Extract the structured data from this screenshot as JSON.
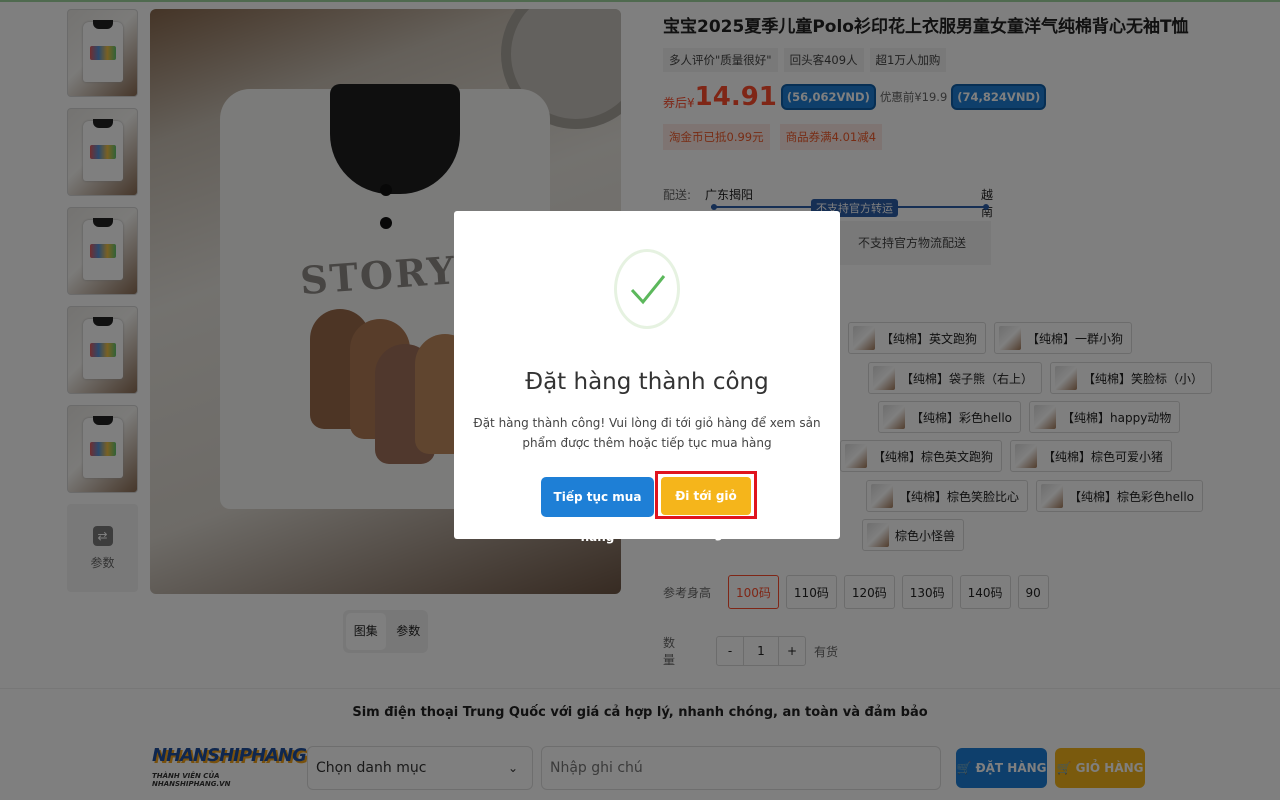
{
  "product": {
    "title": "宝宝2025夏季儿童Polo衫印花上衣服男童女童洋气纯棉背心无袖T恤",
    "tags": [
      "多人评价\"质量很好\"",
      "回头客409人",
      "超1万人加购"
    ],
    "price_label": "券后¥",
    "price": "14.91",
    "price_vnd": "(56,062VND)",
    "orig_price": "优惠前¥19.9",
    "orig_vnd": "(74,824VND)",
    "coupons": [
      "淘金币已抵0.99元",
      "商品券满4.01减4"
    ]
  },
  "gallery": {
    "param_label": "参数",
    "tabs": [
      "图集",
      "参数"
    ],
    "print_text": "STORYBOO"
  },
  "shipping": {
    "label": "配送:",
    "from": "广东揭阳",
    "to": "越南",
    "badge": "不支持官方转运",
    "no_support": "不支持官方物流配送"
  },
  "variants": {
    "row1": [
      "【纯棉】英文跑狗",
      "【纯棉】一群小狗"
    ],
    "row2": [
      "【纯棉】袋子熊（右上）",
      "【纯棉】笑脸标（小）"
    ],
    "row3": [
      "【纯棉】彩色hello",
      "【纯棉】happy动物"
    ],
    "row4": [
      "【纯棉】棕色英文跑狗",
      "【纯棉】棕色可爱小猪"
    ],
    "row5": [
      "【纯棉】棕色笑脸比心",
      "【纯棉】棕色彩色hello"
    ],
    "row6": [
      "棕色小怪兽"
    ]
  },
  "sizes": {
    "label": "参考身高",
    "options": [
      "100码",
      "110码",
      "120码",
      "130码",
      "140码",
      "90"
    ]
  },
  "quantity": {
    "label": "数量",
    "minus": "-",
    "value": "1",
    "plus": "+",
    "stock": "有货"
  },
  "footer": {
    "slogan": "Sim điện thoại Trung Quốc với giá cả hợp lý, nhanh chóng, an toàn và đảm bảo",
    "logo_text": "NHANSHIPHANG",
    "logo_sub": "THÀNH VIÊN CỦA NHANSHIPHANG.VN",
    "category_placeholder": "Chọn danh mục",
    "note_placeholder": "Nhập ghi chú",
    "order_button": "ĐẶT HÀNG",
    "cart_button": "GIỎ HÀNG"
  },
  "modal": {
    "title": "Đặt hàng thành công",
    "message": "Đặt hàng thành công! Vui lòng đi tới giỏ hàng để xem sản phẩm được thêm hoặc tiếp tục mua hàng",
    "continue_button": "Tiếp tục mua hàng",
    "cart_button": "Đi tới giỏ hàng"
  },
  "colors": {
    "accent_blue": "#1e7fd6",
    "accent_orange": "#f5b51b",
    "price_red": "#ff4d2d",
    "highlight_red": "#e0141e",
    "success_green": "#5cb85c"
  }
}
